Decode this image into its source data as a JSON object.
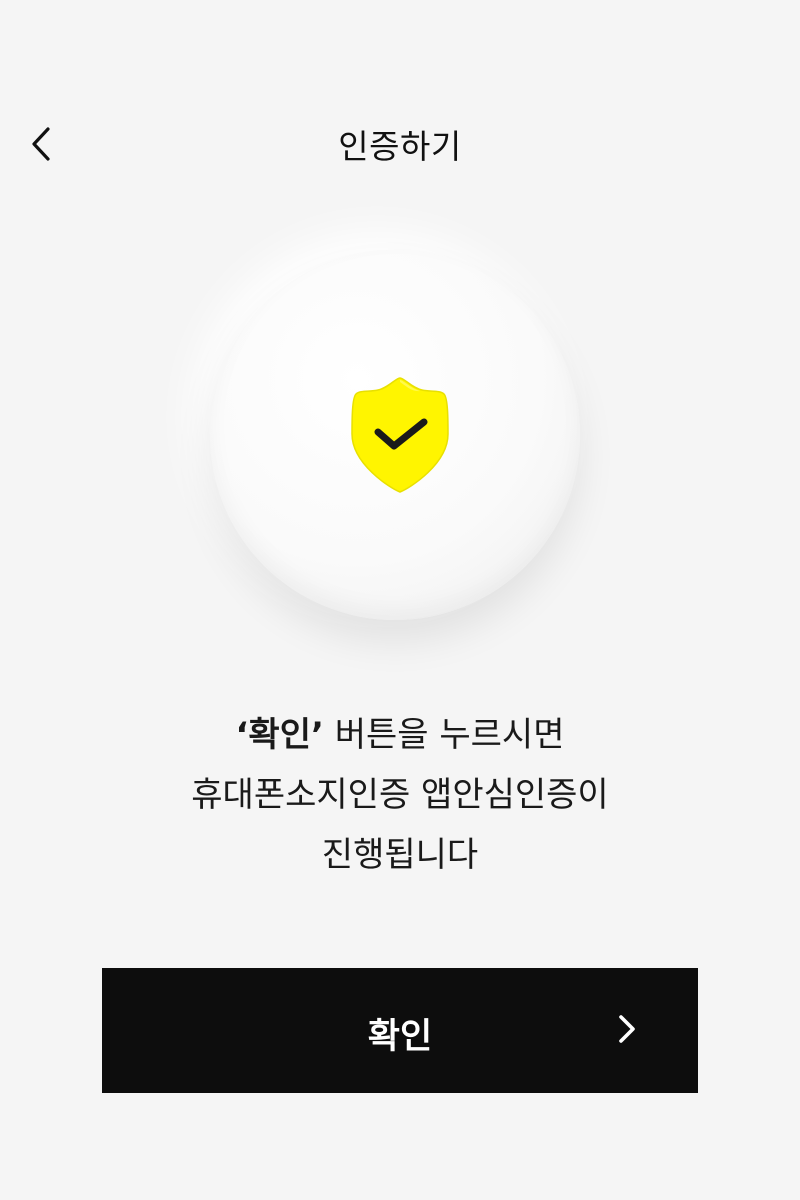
{
  "header": {
    "title": "인증하기",
    "back_icon": "chevron-left-icon"
  },
  "badge": {
    "icon": "shield-check-icon",
    "shield_color": "#fff500",
    "check_color": "#1a1a1a"
  },
  "message": {
    "line1_highlight": "‘확인’",
    "line1_rest": " 버튼을 누르시면",
    "line2": "휴대폰소지인증 앱안심인증이",
    "line3": "진행됩니다"
  },
  "confirm_button": {
    "label": "확인",
    "icon": "chevron-right-icon",
    "background": "#0d0d0d"
  }
}
